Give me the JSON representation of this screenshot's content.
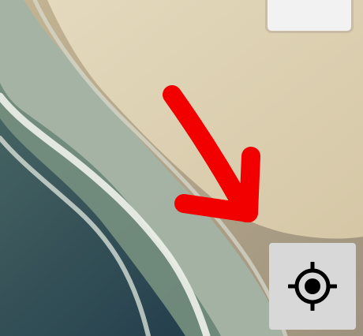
{
  "map": {
    "view": "satellite",
    "annotation": "red-arrow-pointing-down-right"
  },
  "controls": {
    "top_panel": "",
    "locate_button": {
      "icon": "crosshair-locate-icon"
    }
  },
  "colors": {
    "sand": "#d8cba9",
    "wet_sand": "#b3a68a",
    "surf": "#b9c2b6",
    "shallow_water": "#6f8778",
    "deep_water": "#1f3848",
    "arrow": "#f20000",
    "button": "#d8d8d8"
  }
}
